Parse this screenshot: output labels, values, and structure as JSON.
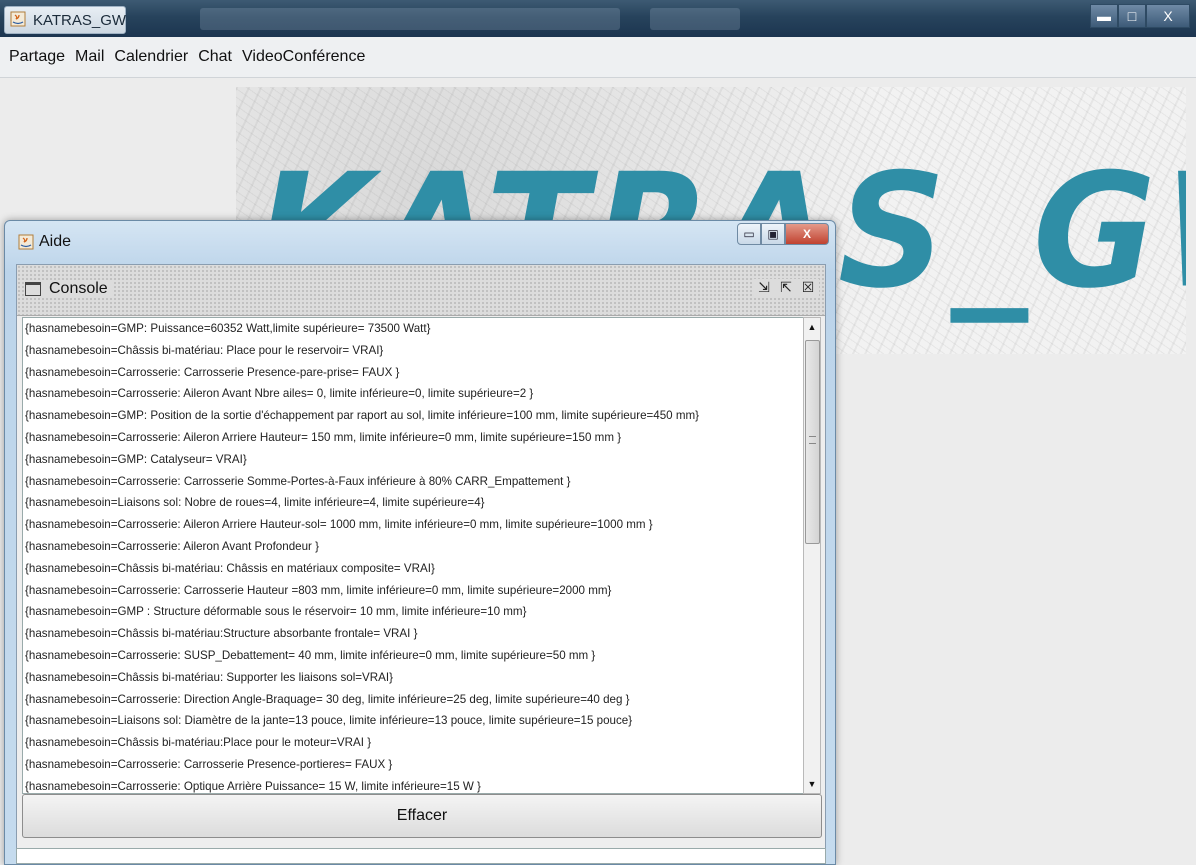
{
  "app": {
    "title": "KATRAS_GW"
  },
  "menu": {
    "items": [
      "Partage",
      "Mail",
      "Calendrier",
      "Chat",
      "VideoConférence"
    ]
  },
  "banner": {
    "text": "KATRAS_GW"
  },
  "aide": {
    "title": "Aide",
    "console": {
      "title": "Console",
      "lines": [
        "{hasnamebesoin=GMP: Puissance=60352 Watt,limite supérieure= 73500 Watt}",
        "{hasnamebesoin=Châssis bi-matériau: Place pour le reservoir= VRAI}",
        "{hasnamebesoin=Carrosserie: Carrosserie Presence-pare-prise= FAUX }",
        "{hasnamebesoin=Carrosserie: Aileron Avant Nbre ailes= 0, limite inférieure=0, limite supérieure=2 }",
        "{hasnamebesoin=GMP: Position de la sortie d'échappement par raport au sol, limite inférieure=100 mm, limite supérieure=450 mm}",
        "{hasnamebesoin=Carrosserie: Aileron Arriere Hauteur= 150 mm, limite inférieure=0 mm, limite supérieure=150 mm }",
        "{hasnamebesoin=GMP: Catalyseur= VRAI}",
        "{hasnamebesoin=Carrosserie: Carrosserie Somme-Portes-à-Faux inférieure à 80% CARR_Empattement }",
        "{hasnamebesoin=Liaisons sol: Nobre de roues=4, limite inférieure=4, limite supérieure=4}",
        "{hasnamebesoin=Carrosserie: Aileron Arriere Hauteur-sol= 1000 mm, limite inférieure=0 mm, limite supérieure=1000 mm }",
        "{hasnamebesoin=Carrosserie: Aileron Avant Profondeur }",
        "{hasnamebesoin=Châssis bi-matériau: Châssis en matériaux composite= VRAI}",
        "{hasnamebesoin=Carrosserie: Carrosserie Hauteur =803 mm, limite inférieure=0 mm, limite supérieure=2000 mm}",
        "{hasnamebesoin=GMP : Structure déformable sous le réservoir= 10 mm, limite inférieure=10 mm}",
        "{hasnamebesoin=Châssis bi-matériau:Structure absorbante frontale= VRAI }",
        "{hasnamebesoin=Carrosserie: SUSP_Debattement= 40 mm, limite inférieure=0 mm, limite supérieure=50 mm }",
        "{hasnamebesoin=Châssis bi-matériau: Supporter les liaisons sol=VRAI}",
        "{hasnamebesoin=Carrosserie: Direction Angle-Braquage= 30 deg, limite inférieure=25 deg, limite supérieure=40 deg }",
        "{hasnamebesoin=Liaisons sol: Diamètre de la jante=13 pouce, limite inférieure=13 pouce, limite supérieure=15 pouce}",
        "{hasnamebesoin=Châssis bi-matériau:Place pour le moteur=VRAI }",
        "{hasnamebesoin=Carrosserie: Carrosserie Presence-portieres= FAUX }",
        "{hasnamebesoin=Carrosserie: Optique Arrière Puissance= 15 W, limite inférieure=15 W }"
      ]
    },
    "clear_button": "Effacer"
  },
  "colors": {
    "banner_text": "#2f8ea6",
    "titlebar": "#27435c"
  },
  "icons": [
    "java-icon",
    "minimize-icon",
    "maximize-icon",
    "close-icon",
    "console-frame-icon"
  ]
}
